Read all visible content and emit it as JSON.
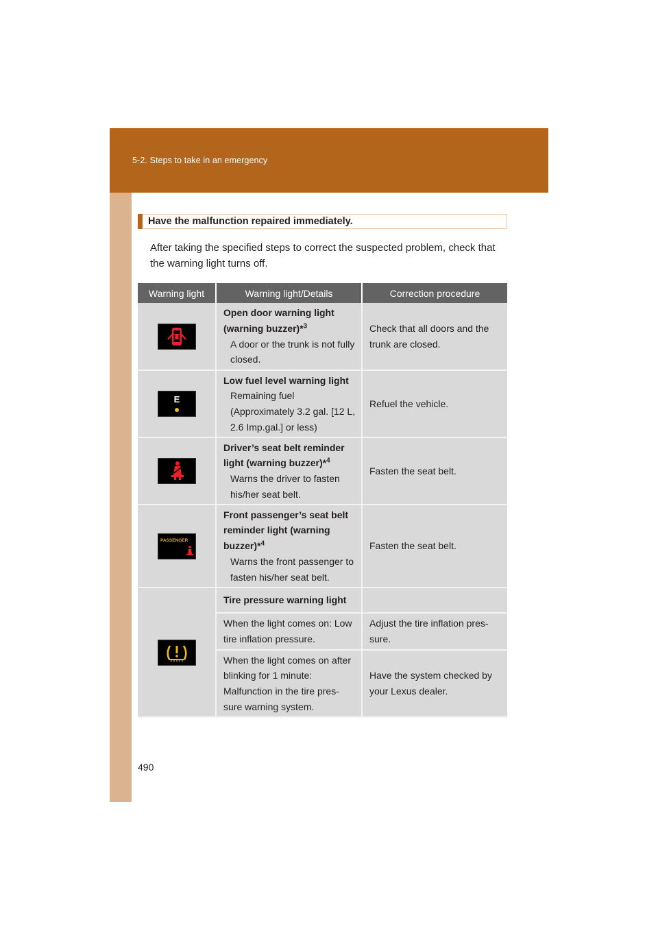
{
  "header": {
    "section_title": "5-2. Steps to take in an emergency"
  },
  "page_number": "490",
  "callout": {
    "title": "Have the malfunction repaired immediately."
  },
  "intro": "After taking the specified steps to correct the suspected problem, check that the warning light turns off.",
  "table": {
    "headers": [
      "Warning light",
      "Warning light/Details",
      "Correction procedure"
    ],
    "rows": [
      {
        "icon": "open-door-icon",
        "title": "Open door warning light (warning buzzer)*",
        "footnote": "3",
        "detail": "A door or the trunk is not fully closed.",
        "procedure": "Check that all doors and the trunk are closed."
      },
      {
        "icon": "low-fuel-icon",
        "icon_text": "E",
        "title": "Low fuel level warning light",
        "footnote": "",
        "detail": "Remaining fuel (Approximately 3.2 gal. [12 L, 2.6 Imp.gal.] or less)",
        "procedure": "Refuel the vehicle."
      },
      {
        "icon": "seat-belt-icon",
        "title": "Driver’s seat belt reminder light (warning buzzer)*",
        "footnote": "4",
        "detail": "Warns the driver to fasten his/her seat belt.",
        "procedure": "Fasten the seat belt."
      },
      {
        "icon": "passenger-seat-belt-icon",
        "icon_text": "PASSENGER",
        "title": "Front passenger’s seat belt reminder light (warning buzzer)*",
        "footnote": "4",
        "detail": "Warns the front passenger to fasten his/her seat belt.",
        "procedure": "Fasten the seat belt."
      },
      {
        "icon": "tire-pressure-icon",
        "title": "Tire pressure warning light",
        "subrows": [
          {
            "condition": "When the light comes on: Low tire inflation pressure.",
            "procedure": "Adjust the tire inflation pres-sure."
          },
          {
            "condition": "When the light comes on after blinking for 1 minute: Malfunction in the tire pres-sure warning system.",
            "procedure": "Have the system checked by your Lexus dealer."
          }
        ]
      }
    ]
  },
  "colors": {
    "brand": "#b3651b",
    "strip": "#dbb48f",
    "table_header": "#636363",
    "table_cell": "#d9d9d9",
    "lamp_red": "#e8202a",
    "lamp_amber": "#f6b51b"
  }
}
